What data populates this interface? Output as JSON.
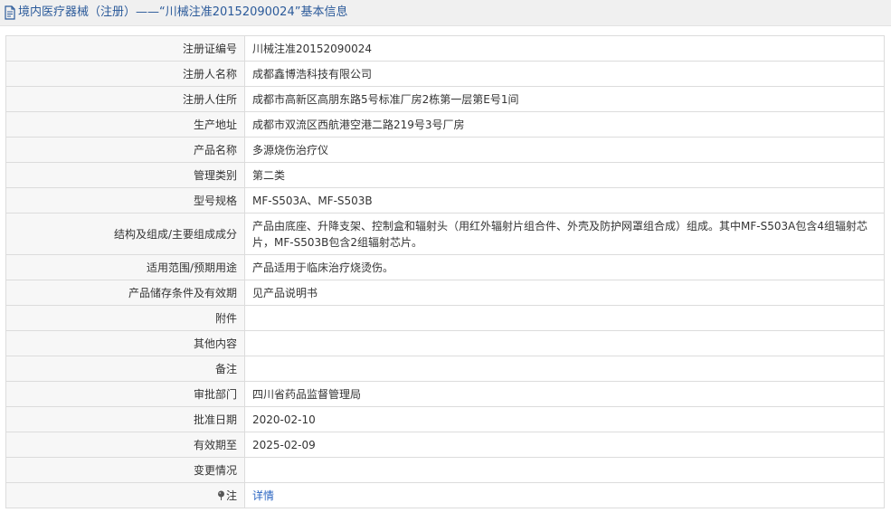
{
  "header": {
    "title": "境内医疗器械（注册）——“川械注准20152090024”基本信息"
  },
  "rows": [
    {
      "label": "注册证编号",
      "value": "川械注准20152090024"
    },
    {
      "label": "注册人名称",
      "value": "成都鑫博浩科技有限公司"
    },
    {
      "label": "注册人住所",
      "value": "成都市高新区高朋东路5号标准厂房2栋第一层第E号1间"
    },
    {
      "label": "生产地址",
      "value": "成都市双流区西航港空港二路219号3号厂房"
    },
    {
      "label": "产品名称",
      "value": "多源烧伤治疗仪"
    },
    {
      "label": "管理类别",
      "value": "第二类"
    },
    {
      "label": "型号规格",
      "value": "MF-S503A、MF-S503B"
    },
    {
      "label": "结构及组成/主要组成成分",
      "value": "产品由底座、升降支架、控制盒和辐射头（用红外辐射片组合件、外壳及防护网罩组合成）组成。其中MF-S503A包含4组辐射芯片，MF-S503B包含2组辐射芯片。"
    },
    {
      "label": "适用范围/预期用途",
      "value": "产品适用于临床治疗烧烫伤。"
    },
    {
      "label": "产品储存条件及有效期",
      "value": "见产品说明书"
    },
    {
      "label": "附件",
      "value": ""
    },
    {
      "label": "其他内容",
      "value": ""
    },
    {
      "label": "备注",
      "value": ""
    },
    {
      "label": "审批部门",
      "value": "四川省药品监督管理局"
    },
    {
      "label": "批准日期",
      "value": "2020-02-10"
    },
    {
      "label": "有效期至",
      "value": "2025-02-09"
    },
    {
      "label": "变更情况",
      "value": ""
    }
  ],
  "note_row": {
    "label": "注",
    "link_text": "详情",
    "icon": "pin-icon"
  },
  "colors": {
    "header_text": "#2b5a9a",
    "link": "#2b66c2",
    "label_bg": "#f7f7f7",
    "border": "#dcdcdc"
  }
}
